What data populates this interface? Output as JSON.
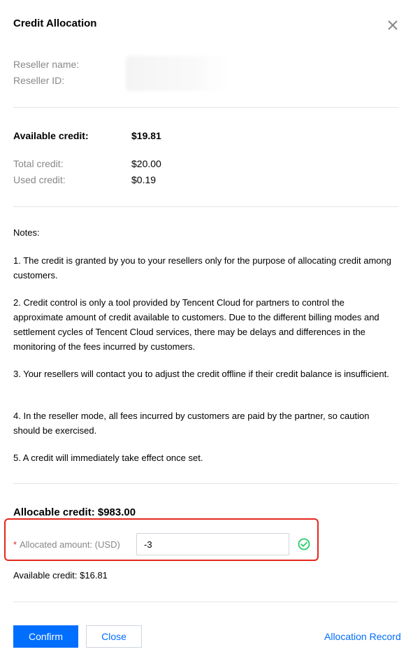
{
  "dialog": {
    "title": "Credit Allocation"
  },
  "reseller": {
    "name_label": "Reseller name:",
    "id_label": "Reseller ID:"
  },
  "credit": {
    "available_label": "Available credit:",
    "available_value": "$19.81",
    "total_label": "Total credit:",
    "total_value": "$20.00",
    "used_label": "Used credit:",
    "used_value": "$0.19"
  },
  "notes": {
    "heading": "Notes:",
    "items": [
      "1. The credit is granted by you to your resellers only for the purpose of allocating credit among customers.",
      "2. Credit control is only a tool provided by Tencent Cloud for partners to control the approximate amount of credit available to customers. Due to the different billing modes and settlement cycles of Tencent Cloud services, there may be delays and differences in the monitoring of the fees incurred by customers.",
      "3. Your resellers will contact you to adjust the credit offline if their credit balance is insufficient.",
      "4. In the reseller mode, all fees incurred by customers are paid by the partner, so caution should be exercised.",
      "5. A credit will immediately take effect once set."
    ]
  },
  "allocation": {
    "allocable_text": "Allocable credit: $983.00",
    "required_mark": "*",
    "amount_label": "Allocated amount: (USD)",
    "amount_value": "-3",
    "available_after_text": "Available credit: $16.81"
  },
  "footer": {
    "confirm_label": "Confirm",
    "close_label": "Close",
    "record_link": "Allocation Record"
  },
  "colors": {
    "primary": "#006eff",
    "highlight": "#e5271b",
    "success": "#29cc6a"
  },
  "icons": {
    "close": "close-icon",
    "valid": "check-circle-icon"
  }
}
